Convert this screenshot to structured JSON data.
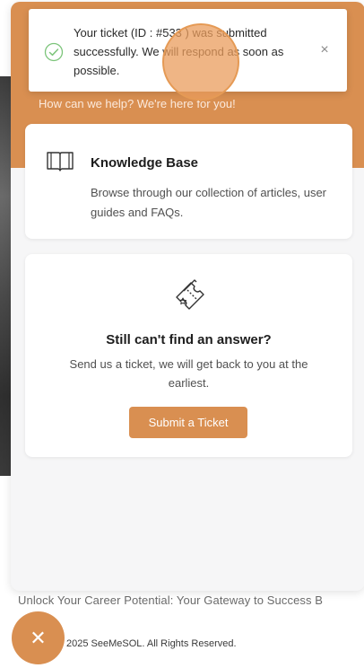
{
  "background_page": {
    "tagline": "Unlock Your Career Potential: Your Gateway to Success B",
    "copyright": "2025 SeeMeSOL. All Rights Reserved."
  },
  "toast": {
    "message": "Your ticket (ID : #533 ) was submitted successfully. We will respond as soon as possible.",
    "close_symbol": "×",
    "icon": "check-circle-icon"
  },
  "widget": {
    "subtitle": "How can we help? We're here for you!",
    "knowledge_base": {
      "icon": "book-icon",
      "title": "Knowledge Base",
      "description": "Browse through our collection of articles, user guides and FAQs."
    },
    "ticket": {
      "icon": "tickets-icon",
      "title": "Still can't find an answer?",
      "description": "Send us a ticket, we will get back to you at the earliest.",
      "button_label": "Submit a Ticket"
    }
  },
  "launcher": {
    "symbol": "✕",
    "icon": "close-icon"
  },
  "colors": {
    "accent": "#d98f51",
    "panel_bg": "#f6f6f7",
    "success": "#7cc47a"
  }
}
